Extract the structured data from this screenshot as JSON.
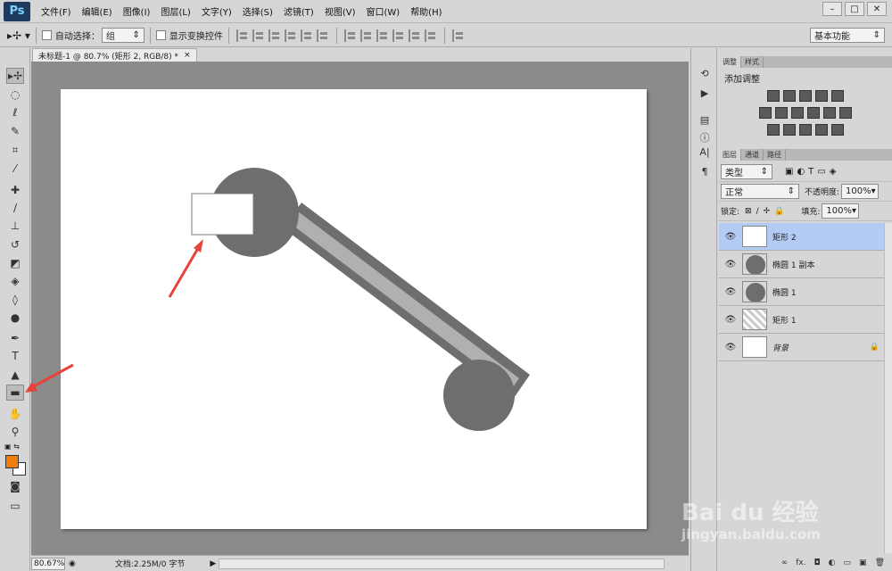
{
  "app": {
    "logo": "Ps",
    "menus": [
      "文件(F)",
      "编辑(E)",
      "图像(I)",
      "图层(L)",
      "文字(Y)",
      "选择(S)",
      "滤镜(T)",
      "视图(V)",
      "窗口(W)",
      "帮助(H)"
    ],
    "window_controls": [
      "–",
      "□",
      "✕"
    ]
  },
  "options_bar": {
    "auto_select_label": "自动选择：",
    "auto_select_value": "组",
    "show_transform_label": "显示变换控件",
    "workspace": "基本功能"
  },
  "document": {
    "tab_title": "未标题-1 @ 80.7% (矩形 2, RGB/8) *",
    "tab_close": "×",
    "zoom": "80.67%",
    "doc_info": "文档:2.25M/0 字节",
    "canvas_colors": {
      "shape_dark": "#6e6d70",
      "shape_light": "#b0afb2",
      "arrow": "#e8433a"
    }
  },
  "colors": {
    "foreground": "#f07d0c",
    "background": "#ffffff"
  },
  "adjustments_panel": {
    "tabs": [
      "调整",
      "样式"
    ],
    "title": "添加调整"
  },
  "layers_panel": {
    "tabs": [
      "图层",
      "通道",
      "路径"
    ],
    "filter_kind": "类型",
    "blend_mode": "正常",
    "opacity_label": "不透明度:",
    "opacity_value": "100%",
    "lock_label": "锁定:",
    "fill_label": "填充:",
    "fill_value": "100%",
    "layers": [
      {
        "name": "矩形 2",
        "selected": true
      },
      {
        "name": "椭圆 1 副本",
        "selected": false
      },
      {
        "name": "椭圆 1",
        "selected": false
      },
      {
        "name": "矩形 1",
        "selected": false
      },
      {
        "name": "背景",
        "selected": false
      }
    ]
  },
  "watermark": {
    "line1": "Bai du 经验",
    "line2": "jingyan.baidu.com"
  }
}
